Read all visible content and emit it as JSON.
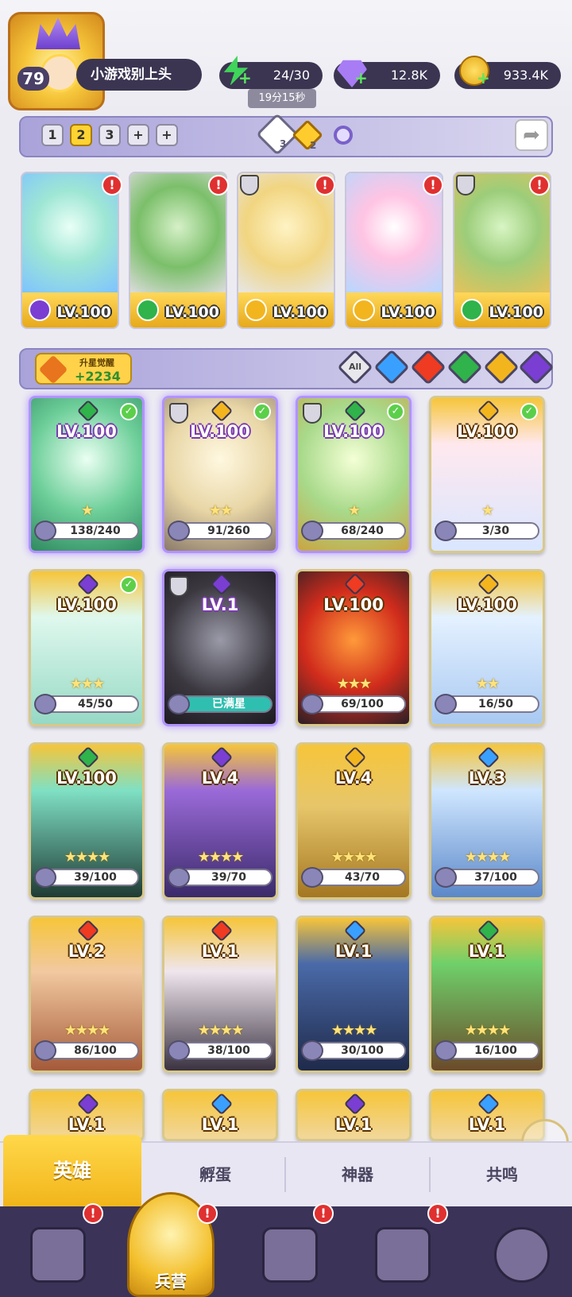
{
  "player": {
    "level": "79",
    "name": "小游戏别上头"
  },
  "resources": {
    "energy": "24/30",
    "energy_timer": "19分15秒",
    "gems": "12.8K",
    "coins": "933.4K"
  },
  "team_slots": [
    "1",
    "2",
    "3",
    "+",
    "+"
  ],
  "team_slot_active": "2",
  "pentagram": {
    "white_count": "3",
    "gold_count": "2"
  },
  "team": [
    {
      "level": "LV.100",
      "element": "dark",
      "alert": "!"
    },
    {
      "level": "LV.100",
      "element": "nature",
      "alert": "!"
    },
    {
      "level": "LV.100",
      "element": "light",
      "alert": "!"
    },
    {
      "level": "LV.100",
      "element": "light",
      "alert": "!"
    },
    {
      "level": "LV.100",
      "element": "nature",
      "alert": "!"
    }
  ],
  "awaken": {
    "label": "升星觉醒",
    "value": "+2234"
  },
  "filters": {
    "all": "All",
    "elements": [
      "water",
      "fire",
      "nature",
      "light",
      "dark"
    ]
  },
  "heroes": [
    {
      "level": "LV.100",
      "progress": "138/240",
      "element": "nature",
      "check": true
    },
    {
      "level": "LV.100",
      "progress": "91/260",
      "element": "light",
      "check": true
    },
    {
      "level": "LV.100",
      "progress": "68/240",
      "element": "nature",
      "check": true
    },
    {
      "level": "LV.100",
      "progress": "3/30",
      "element": "light",
      "check": true
    },
    {
      "level": "LV.100",
      "progress": "45/50",
      "element": "dark",
      "check": true
    },
    {
      "level": "LV.1",
      "progress": "已满星",
      "element": "dark",
      "check": false
    },
    {
      "level": "LV.100",
      "progress": "69/100",
      "element": "fire",
      "check": false
    },
    {
      "level": "LV.100",
      "progress": "16/50",
      "element": "light",
      "check": false
    },
    {
      "level": "LV.100",
      "progress": "39/100",
      "element": "nature",
      "check": false
    },
    {
      "level": "LV.4",
      "progress": "39/70",
      "element": "dark",
      "check": false
    },
    {
      "level": "LV.4",
      "progress": "43/70",
      "element": "light",
      "check": false
    },
    {
      "level": "LV.3",
      "progress": "37/100",
      "element": "water",
      "check": false
    },
    {
      "level": "LV.2",
      "progress": "86/100",
      "element": "fire",
      "check": false
    },
    {
      "level": "LV.1",
      "progress": "38/100",
      "element": "fire",
      "check": false
    },
    {
      "level": "LV.1",
      "progress": "30/100",
      "element": "water",
      "check": false
    },
    {
      "level": "LV.1",
      "progress": "16/100",
      "element": "nature",
      "check": false
    },
    {
      "level": "LV.1",
      "progress": "",
      "element": "dark",
      "check": false
    },
    {
      "level": "LV.1",
      "progress": "",
      "element": "water",
      "check": false
    },
    {
      "level": "LV.1",
      "progress": "",
      "element": "dark",
      "check": false
    },
    {
      "level": "LV.1",
      "progress": "",
      "element": "water",
      "check": false
    }
  ],
  "subtabs": {
    "hero": "英雄",
    "hatch": "孵蛋",
    "artifact": "神器",
    "resonance": "共鸣"
  },
  "nav": {
    "barracks": "兵营",
    "alert": "!"
  },
  "colors": {
    "water": "#3aa0ff",
    "fire": "#ee3b21",
    "nature": "#2fb34a",
    "light": "#f3b51e",
    "dark": "#7a3ed3"
  }
}
